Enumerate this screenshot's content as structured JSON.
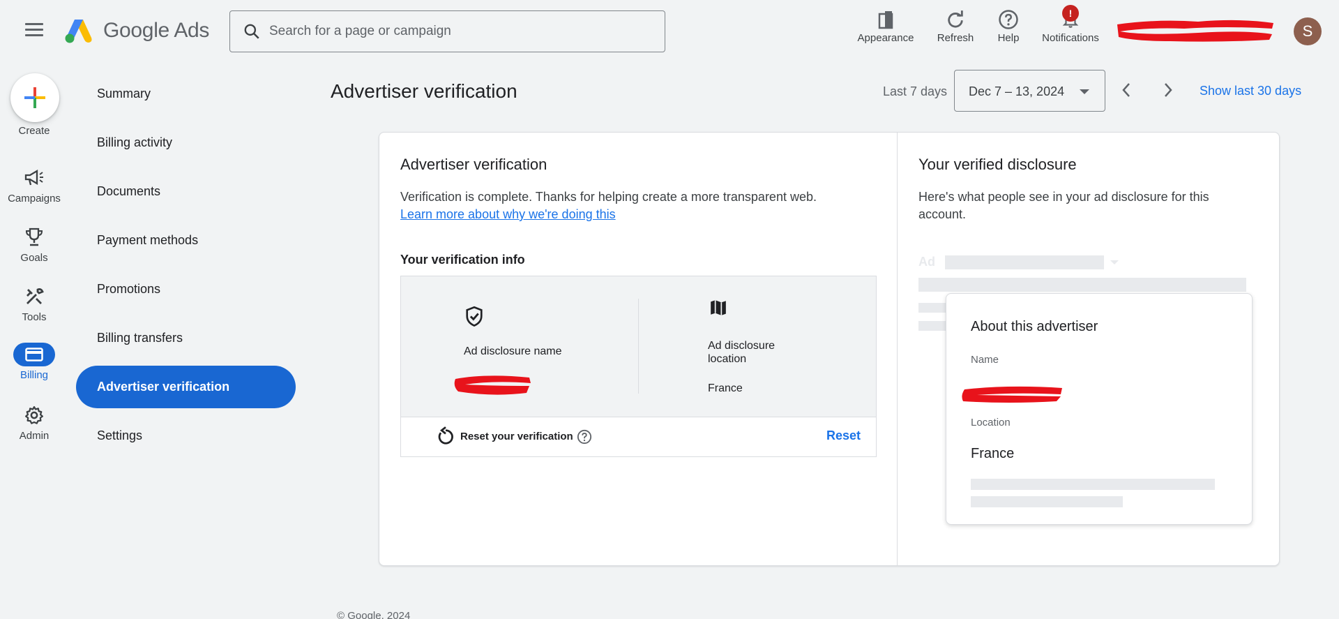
{
  "header": {
    "brand": "Google Ads",
    "search_placeholder": "Search for a page or campaign",
    "tools": [
      {
        "label": "Appearance",
        "icon": "appearance-icon"
      },
      {
        "label": "Refresh",
        "icon": "refresh-icon"
      },
      {
        "label": "Help",
        "icon": "help-icon"
      },
      {
        "label": "Notifications",
        "icon": "bell-icon",
        "badge": "!"
      }
    ],
    "avatar_initial": "S"
  },
  "rail": {
    "create_label": "Create",
    "items": [
      {
        "label": "Campaigns",
        "icon": "megaphone-icon"
      },
      {
        "label": "Goals",
        "icon": "trophy-icon"
      },
      {
        "label": "Tools",
        "icon": "tools-icon"
      },
      {
        "label": "Billing",
        "icon": "credit-card-icon",
        "active": true
      },
      {
        "label": "Admin",
        "icon": "gear-icon"
      }
    ]
  },
  "subnav": {
    "items": [
      "Summary",
      "Billing activity",
      "Documents",
      "Payment methods",
      "Promotions",
      "Billing transfers"
    ],
    "active": "Advertiser verification",
    "after_active": [
      "Settings"
    ]
  },
  "page": {
    "title": "Advertiser verification",
    "range_label": "Last 7 days",
    "date_range": "Dec 7 – 13, 2024",
    "show_last_30": "Show last 30 days"
  },
  "left_panel": {
    "title": "Advertiser verification",
    "message": "Verification is complete. Thanks for helping create a more transparent web.",
    "learn_more": "Learn more about why we're doing this",
    "section_title": "Your verification info",
    "name_label": "Ad disclosure name",
    "location_label_line1": "Ad disclosure",
    "location_label_line2": "location",
    "location_value": "France",
    "reset_text": "Reset your verification",
    "reset_button": "Reset"
  },
  "right_panel": {
    "title": "Your verified disclosure",
    "description": "Here's what people see in your ad disclosure for this account.",
    "ad_tag": "Ad",
    "about": {
      "title": "About this advertiser",
      "name_label": "Name",
      "location_label": "Location",
      "location_value": "France"
    }
  },
  "footer": "© Google, 2024",
  "colors": {
    "accent": "#1967d2",
    "link": "#1a73e8",
    "redaction": "#e8131b",
    "badge": "#c5221f"
  }
}
